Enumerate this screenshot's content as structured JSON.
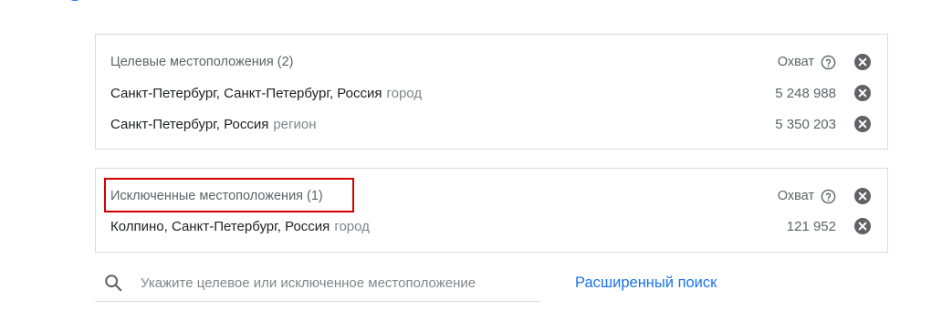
{
  "targets": {
    "title": "Целевые местоположения (2)",
    "reach_label": "Охват",
    "items": [
      {
        "name": "Санкт-Петербург, Санкт-Петербург, Россия",
        "kind": "город",
        "reach": "5 248 988"
      },
      {
        "name": "Санкт-Петербург, Россия",
        "kind": "регион",
        "reach": "5 350 203"
      }
    ]
  },
  "excluded": {
    "title": "Исключенные местоположения (1)",
    "reach_label": "Охват",
    "items": [
      {
        "name": "Колпино, Санкт-Петербург, Россия",
        "kind": "город",
        "reach": "121 952"
      }
    ]
  },
  "search": {
    "placeholder": "Укажите целевое или исключенное местоположение",
    "value": ""
  },
  "advanced_search_label": "Расширенный поиск",
  "colors": {
    "highlight": "#d50000",
    "link": "#1a73e8",
    "icon": "#5f6368",
    "top_icon": "#1a73e8"
  }
}
